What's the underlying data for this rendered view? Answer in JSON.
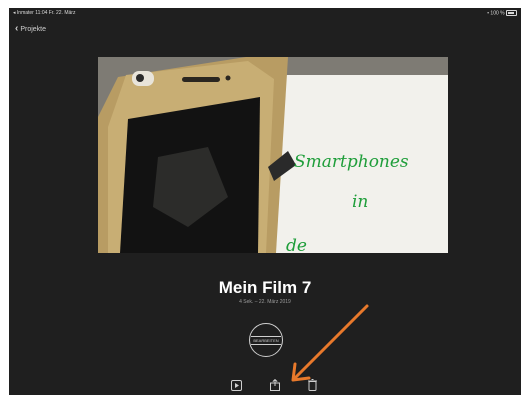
{
  "status_bar": {
    "left_text": "◂ Inmater 11:04 Fr. 22. März",
    "right_text": "• 100 %"
  },
  "nav": {
    "back_label": "Projekte"
  },
  "preview": {
    "handwriting_line1": "Smartphones",
    "handwriting_line2": "in",
    "handwriting_line3": "de"
  },
  "project": {
    "title": "Mein Film 7",
    "meta": "4 Sek. – 22. März 2019"
  },
  "edit_button": {
    "label": "BEARBEITEN"
  },
  "colors": {
    "background": "#1f1f1f",
    "annotation_arrow": "#e8792b"
  },
  "toolbar": {
    "items": [
      "play-icon",
      "share-icon",
      "trash-icon"
    ]
  }
}
